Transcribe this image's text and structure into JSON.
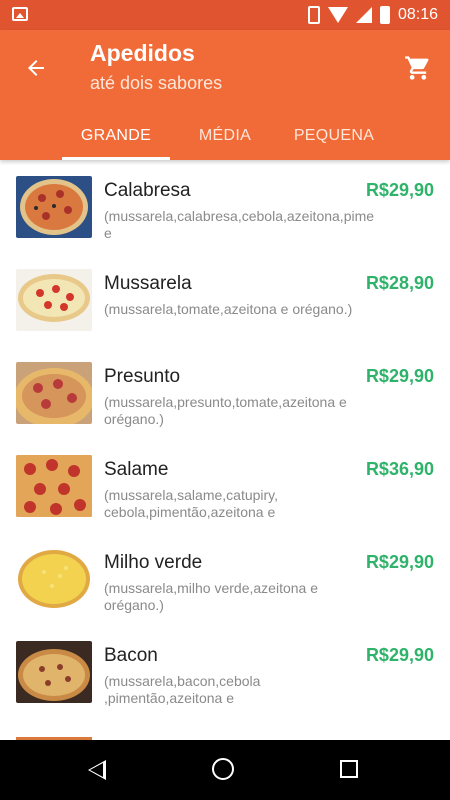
{
  "status_bar": {
    "time": "08:16",
    "icons": [
      "image-icon",
      "vibrate-icon",
      "wifi-icon",
      "signal-icon",
      "battery-icon"
    ]
  },
  "app_bar": {
    "title": "Apedidos",
    "subtitle": "até dois sabores",
    "back_icon": "arrow-left-icon",
    "cart_icon": "shopping-cart-icon"
  },
  "tabs": [
    {
      "label": "GRANDE",
      "active": true
    },
    {
      "label": "MÉDIA",
      "active": false
    },
    {
      "label": "PEQUENA",
      "active": false
    }
  ],
  "items": [
    {
      "name": "Calabresa",
      "description": "(mussarela,calabresa,cebola,azeitona,pimentão e",
      "price": "R$29,90"
    },
    {
      "name": "Mussarela",
      "description": "(mussarela,tomate,azeitona e orégano.)",
      "price": "R$28,90"
    },
    {
      "name": "Presunto",
      "description": "(mussarela,presunto,tomate,azeitona e orégano.)",
      "price": "R$29,90"
    },
    {
      "name": "Salame",
      "description": "(mussarela,salame,catupiry, cebola,pimentão,azeitona e",
      "price": "R$36,90"
    },
    {
      "name": "Milho verde",
      "description": "(mussarela,milho verde,azeitona e orégano.)",
      "price": "R$29,90"
    },
    {
      "name": "Bacon",
      "description": "(mussarela,bacon,cebola ,pimentão,azeitona e",
      "price": "R$29,90"
    }
  ],
  "nav_bar": {
    "icons": [
      "nav-back-icon",
      "nav-home-icon",
      "nav-recents-icon"
    ]
  },
  "colors": {
    "status_bar": "#e0552f",
    "app_bar": "#f06b38",
    "price": "#2fb36a",
    "nav_bar": "#000000"
  }
}
